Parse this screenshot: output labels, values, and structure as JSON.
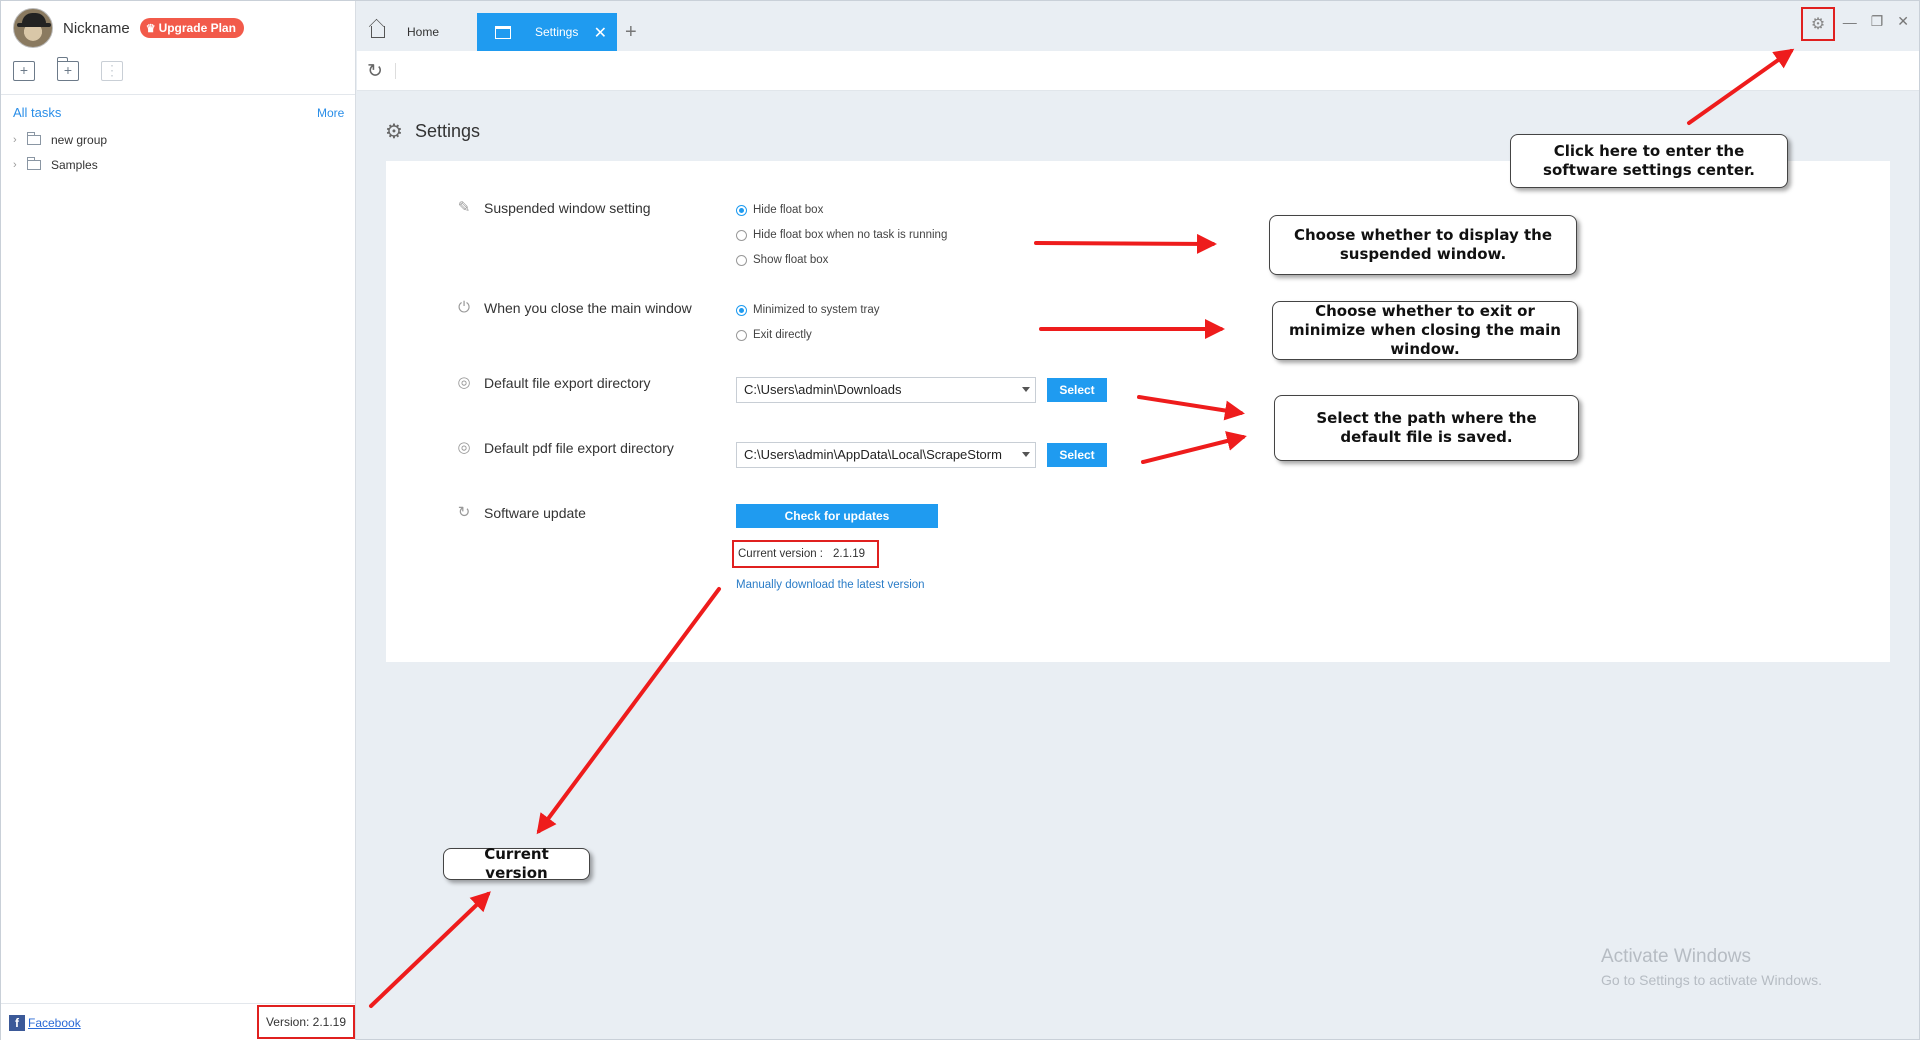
{
  "user": {
    "nickname": "Nickname",
    "upgrade_label": "Upgrade Plan"
  },
  "sidebar": {
    "all_tasks": "All tasks",
    "more": "More",
    "groups": [
      "new group",
      "Samples"
    ],
    "footer": {
      "facebook": "Facebook",
      "version": "Version: 2.1.19"
    }
  },
  "tabs": {
    "home": "Home",
    "settings": "Settings"
  },
  "settings": {
    "title": "Settings",
    "suspended_label": "Suspended window setting",
    "suspended_options": [
      "Hide float box",
      "Hide float box when no task is running",
      "Show float box"
    ],
    "close_label": "When you close the main window",
    "close_options": [
      "Minimized to system tray",
      "Exit directly"
    ],
    "export_label": "Default file export directory",
    "export_value": "C:\\Users\\admin\\Downloads",
    "pdf_label": "Default pdf file export directory",
    "pdf_value": "C:\\Users\\admin\\AppData\\Local\\ScrapeStorm",
    "select_label": "Select",
    "update_label": "Software update",
    "check_label": "Check for updates",
    "current_version_label": "Current version :",
    "current_version": "2.1.19",
    "manual_link": "Manually download the latest version"
  },
  "callouts": {
    "settings_center": "Click here to enter the software settings center.",
    "suspended": "Choose whether to display the suspended window.",
    "close": "Choose whether to exit or minimize when closing the main window.",
    "path": "Select the path where the default file is saved.",
    "version": "Current version"
  },
  "watermark": {
    "line1": "Activate Windows",
    "line2": "Go to Settings to activate Windows."
  },
  "colors": {
    "accent": "#1f9bf0",
    "highlight": "#e0201f",
    "upgrade": "#f25a4a"
  }
}
